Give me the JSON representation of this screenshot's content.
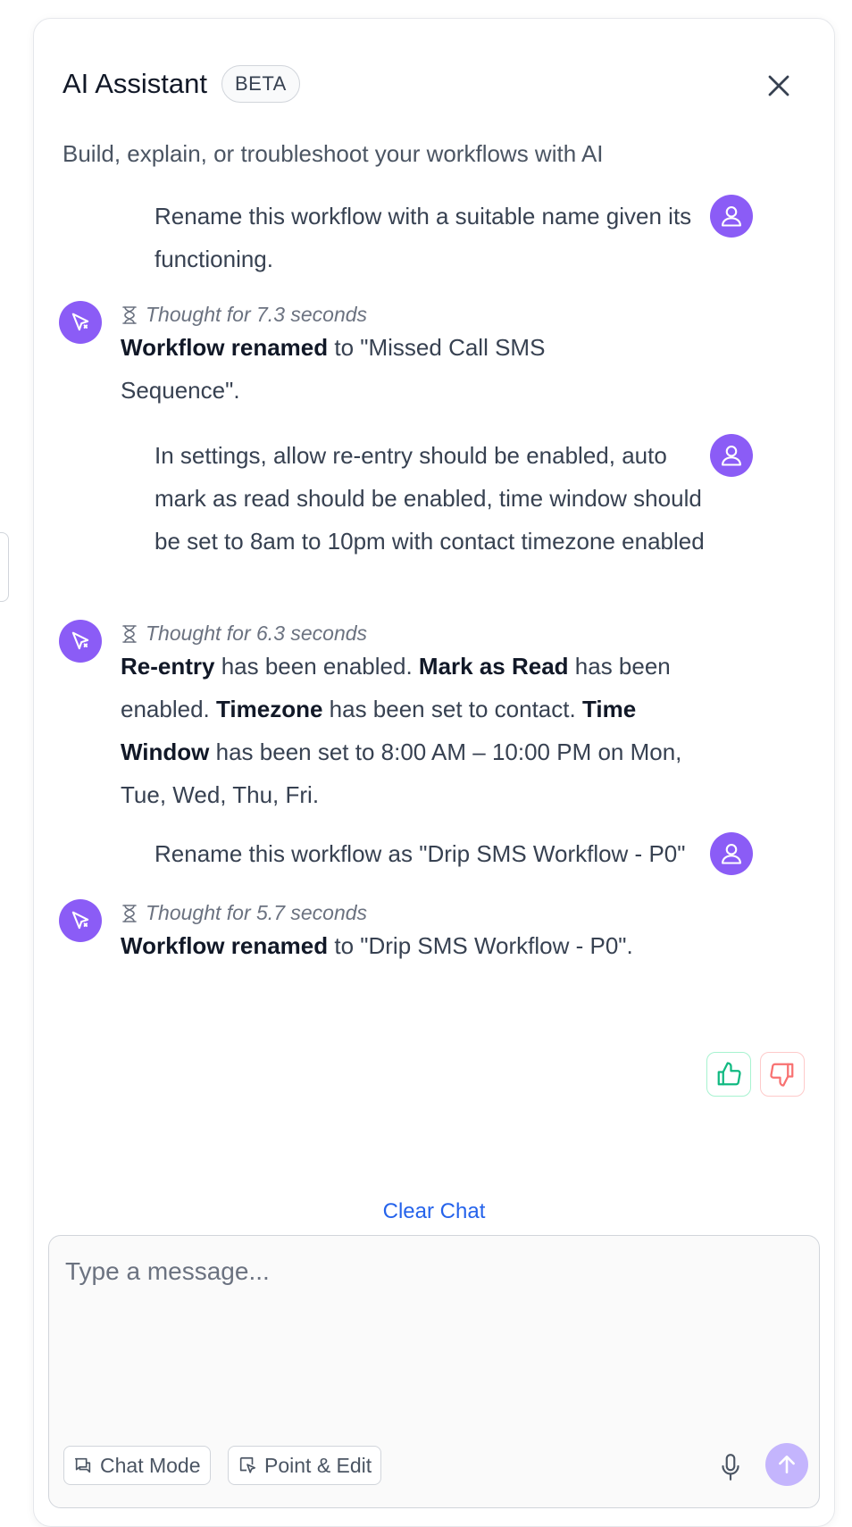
{
  "header": {
    "title": "AI Assistant",
    "badge": "BETA",
    "subtitle": "Build, explain, or troubleshoot your workflows with AI"
  },
  "messages": {
    "user_1": "Rename this workflow with a suitable name given its functioning.",
    "bot_1": {
      "thought": "Thought for 7.3 seconds",
      "b1": "Workflow renamed",
      "t1": " to \"Missed Call SMS Sequence\"."
    },
    "user_2": "In settings, allow re-entry should be enabled, auto mark as read should be enabled, time window should be set to 8am to 10pm with contact timezone enabled",
    "bot_2": {
      "thought": "Thought for 6.3 seconds",
      "b1": "Re-entry",
      "t1": " has been enabled. ",
      "b2": "Mark as Read",
      "t2": " has been enabled. ",
      "b3": "Timezone",
      "t3": " has been set to contact. ",
      "b4": "Time Window",
      "t4": " has been set to 8:00 AM – 10:00 PM on Mon, Tue, Wed, Thu, Fri."
    },
    "user_3": "Rename this workflow as \"Drip SMS Workflow - P0\"",
    "bot_3": {
      "thought": "Thought for 5.7 seconds",
      "b1": "Workflow renamed",
      "t1": " to \"Drip SMS Workflow - P0\"."
    }
  },
  "footer": {
    "clear_chat": "Clear Chat",
    "input_placeholder": "Type a message...",
    "chat_mode": "Chat Mode",
    "point_edit": "Point & Edit"
  },
  "colors": {
    "accent": "#8b5cf6",
    "send_disabled": "#c4b5fd",
    "link": "#2563eb",
    "thumbs_up": "#10b981",
    "thumbs_down": "#f87171"
  },
  "icons": [
    "close-icon",
    "user-icon",
    "bot-icon",
    "hourglass-icon",
    "thumbs-up-icon",
    "thumbs-down-icon",
    "chat-icon",
    "pointer-icon",
    "mic-icon",
    "send-arrow-icon"
  ]
}
